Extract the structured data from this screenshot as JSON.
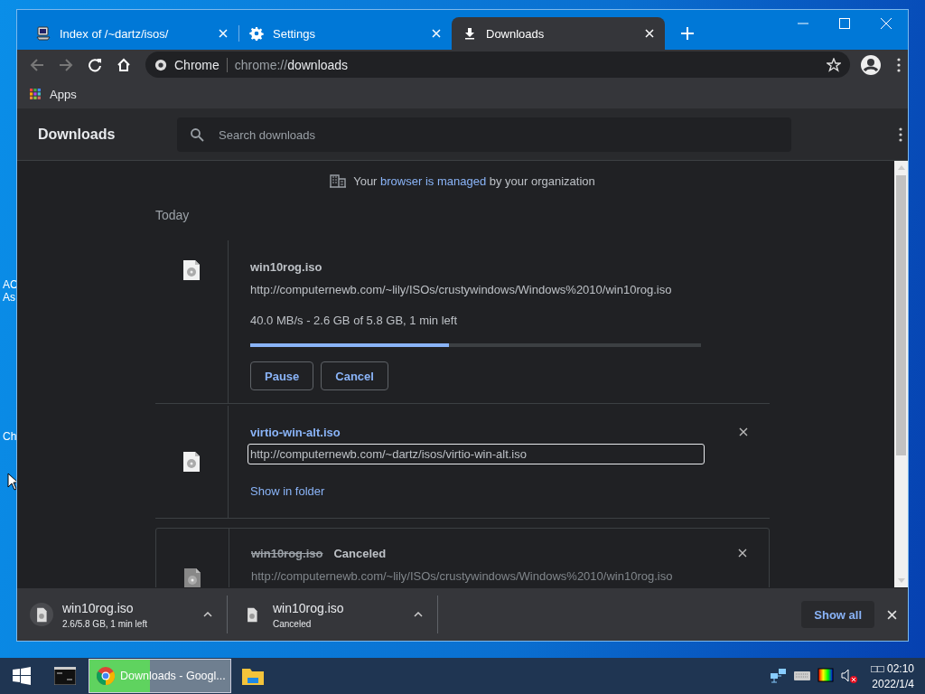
{
  "desktop_labels": [
    "AC",
    "As",
    "Ch"
  ],
  "tabs": [
    {
      "kind": "computer",
      "title": "Index of /~dartz/isos/",
      "selected": false
    },
    {
      "kind": "gear",
      "title": "Settings",
      "selected": false
    },
    {
      "kind": "download",
      "title": "Downloads",
      "selected": true
    }
  ],
  "toolbar": {
    "site_label": "Chrome",
    "url_scheme": "chrome://",
    "url_path": "downloads"
  },
  "bookmarks": [
    {
      "label": "Apps"
    }
  ],
  "page": {
    "title": "Downloads",
    "search": {
      "placeholder": "Search downloads"
    },
    "notice": {
      "before": "Your",
      "link": "browser is managed",
      "after": "by your organization"
    },
    "date_heading": "Today",
    "downloads": [
      {
        "kind": "in_progress",
        "name": "win10rog.iso",
        "url": "http://computernewb.com/~lily/ISOs/crustywindows/Windows%2010/win10rog.iso",
        "status": "40.0 MB/s - 2.6 GB of 5.8 GB, 1 min left",
        "level": 0.44,
        "buttons": [
          "Pause",
          "Cancel"
        ]
      },
      {
        "kind": "complete",
        "name": "virtio-win-alt.iso",
        "url": "http://computernewb.com/~dartz/isos/virtio-win-alt.iso",
        "url_focused": true,
        "action": "Show in folder"
      },
      {
        "kind": "canceled",
        "name": "win10rog.iso",
        "state_label": "Canceled",
        "url": "http://computernewb.com/~lily/ISOs/crustywindows/Windows%2010/win10rog.iso"
      }
    ]
  },
  "shelf": {
    "items": [
      {
        "kind": "in_progress",
        "name": "win10rog.iso",
        "status": "2.6/5.8 GB, 1 min left"
      },
      {
        "kind": "canceled",
        "name": "win10rog.iso",
        "status": "Canceled"
      }
    ],
    "show_all": "Show all"
  },
  "taskbar": {
    "apps": [
      {
        "kind": "terminal"
      },
      {
        "kind": "chrome",
        "label": "Downloads - Googl...",
        "selected": true,
        "level": 0.43
      },
      {
        "kind": "folder"
      }
    ],
    "clock": {
      "time": "□□ 02:10",
      "date": "2022/1/4"
    }
  }
}
